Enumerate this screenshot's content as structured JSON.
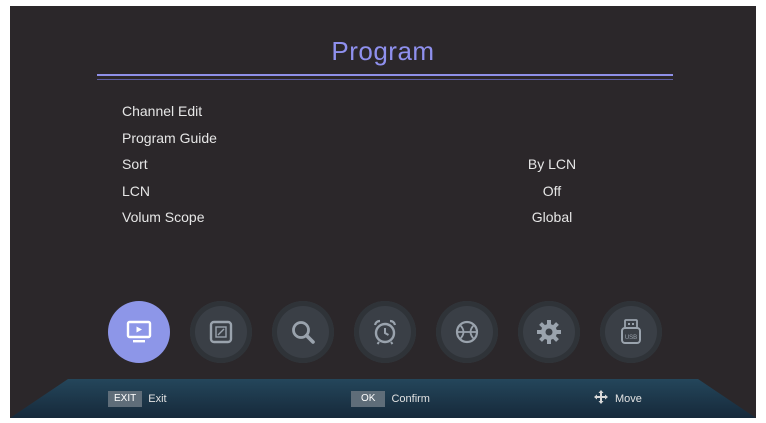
{
  "header": {
    "title": "Program"
  },
  "menu": {
    "items": [
      {
        "label": "Channel Edit",
        "value": ""
      },
      {
        "label": "Program Guide",
        "value": ""
      },
      {
        "label": "Sort",
        "value": "By LCN"
      },
      {
        "label": "LCN",
        "value": "Off"
      },
      {
        "label": "Volum Scope",
        "value": "Global"
      }
    ]
  },
  "icon_bar": {
    "icons": [
      "tv-icon",
      "picture-icon",
      "search-icon",
      "alarm-clock-icon",
      "ball-icon",
      "gear-icon",
      "usb-icon"
    ],
    "selected": "tv-icon",
    "usb_label": "USB"
  },
  "colors": {
    "accent": "#8f90ee",
    "background": "#2b272a",
    "selected_icon": "#8d96e8",
    "footer": "#1c3546"
  },
  "footer": {
    "exit_key": "EXIT",
    "exit_label": "Exit",
    "ok_key": "OK",
    "ok_label": "Confirm",
    "move_label": "Move"
  }
}
